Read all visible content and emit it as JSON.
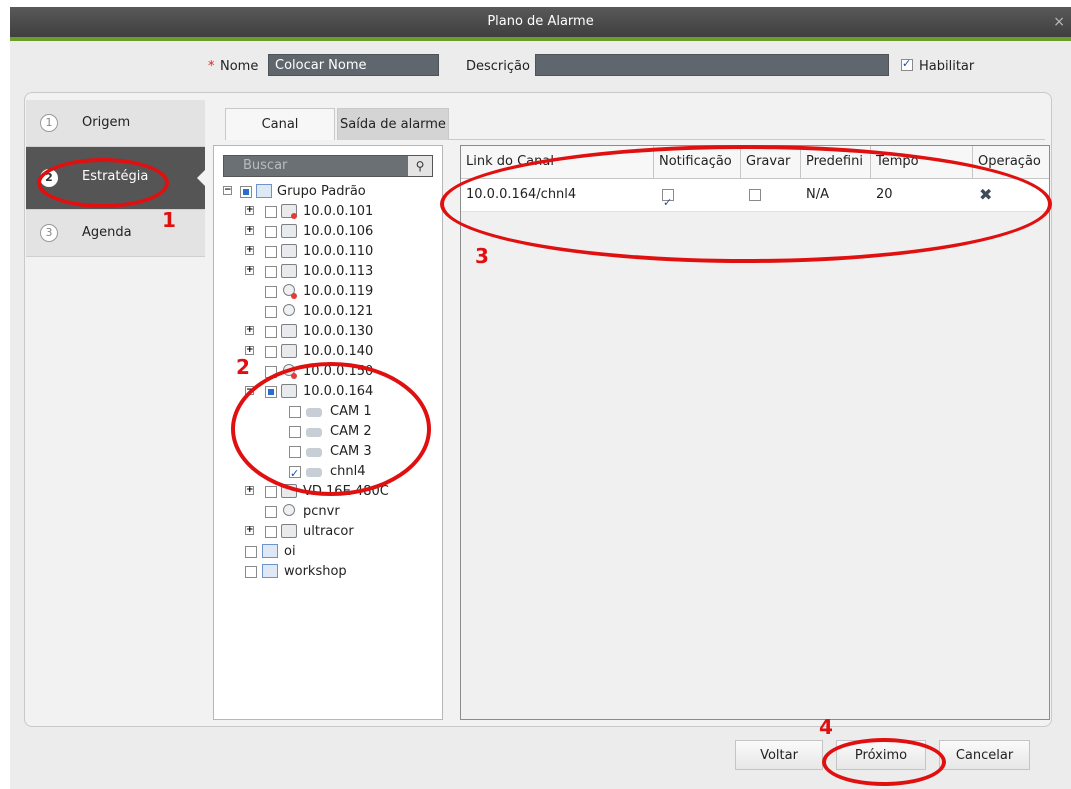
{
  "window": {
    "title": "Plano de Alarme",
    "close": "×"
  },
  "form": {
    "required_mark": "*",
    "name_label": "Nome",
    "name_value": "Colocar Nome",
    "desc_label": "Descrição",
    "desc_value": "",
    "enable_label": "Habilitar",
    "enable_checked": true
  },
  "nav": [
    {
      "num": "1",
      "label": "Origem"
    },
    {
      "num": "2",
      "label": "Estratégia"
    },
    {
      "num": "3",
      "label": "Agenda"
    }
  ],
  "tabs": [
    "Canal",
    "Saída de alarme"
  ],
  "search": {
    "placeholder": "Buscar"
  },
  "tree": [
    {
      "label": "Grupo Padrão",
      "icon": "folder-icon"
    },
    {
      "label": "10.0.0.101",
      "icon": "dvr-offline-icon"
    },
    {
      "label": "10.0.0.106",
      "icon": "dvr-icon"
    },
    {
      "label": "10.0.0.110",
      "icon": "dvr-icon"
    },
    {
      "label": "10.0.0.113",
      "icon": "dvr-icon"
    },
    {
      "label": "10.0.0.119",
      "icon": "ipc-offline-icon"
    },
    {
      "label": "10.0.0.121",
      "icon": "ipc-icon"
    },
    {
      "label": "10.0.0.130",
      "icon": "dvr-icon"
    },
    {
      "label": "10.0.0.140",
      "icon": "dvr-icon"
    },
    {
      "label": "10.0.0.150",
      "icon": "ipc-offline-icon"
    },
    {
      "label": "10.0.0.164",
      "icon": "dvr-icon"
    },
    {
      "label": "CAM 1",
      "icon": "camera-icon"
    },
    {
      "label": "CAM 2",
      "icon": "camera-icon"
    },
    {
      "label": "CAM 3",
      "icon": "camera-icon"
    },
    {
      "label": "chnl4",
      "icon": "camera-icon",
      "checked": true
    },
    {
      "label": "VD 16E 480C",
      "icon": "dvr-icon"
    },
    {
      "label": "pcnvr",
      "icon": "ipc-icon"
    },
    {
      "label": "ultracor",
      "icon": "dvr-icon"
    },
    {
      "label": "oi",
      "icon": "folder-icon"
    },
    {
      "label": "workshop",
      "icon": "folder-icon"
    }
  ],
  "table": {
    "headers": [
      "Link do Canal",
      "Notificação",
      "Gravar",
      "Predefini",
      "Tempo",
      "Operação"
    ],
    "rows": [
      {
        "link": "10.0.0.164/chnl4",
        "notificacao": true,
        "gravar": false,
        "predefini": "N/A",
        "tempo": "20",
        "operacao": "✖"
      }
    ]
  },
  "buttons": {
    "back": "Voltar",
    "next": "Próximo",
    "cancel": "Cancelar"
  },
  "annotations": [
    "1",
    "2",
    "3",
    "4"
  ],
  "colors": {
    "accent_green": "#6c9d2a",
    "annotation_red": "#e01010",
    "active_nav": "#555555"
  }
}
